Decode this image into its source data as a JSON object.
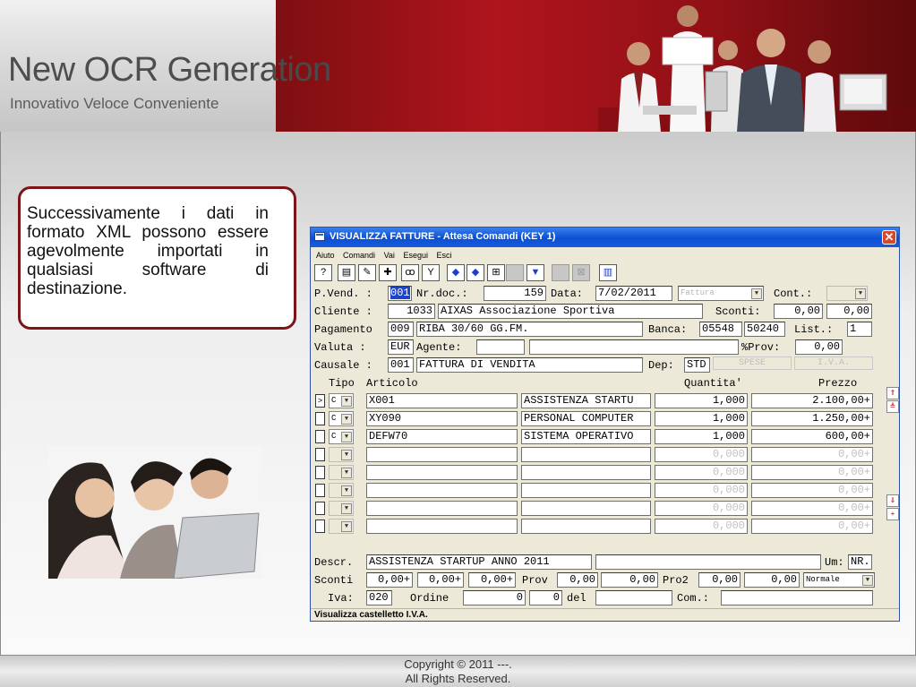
{
  "header": {
    "title_part1": "New OCR Gene",
    "title_part2": "ration",
    "subtitle": "Innovativo Veloce Conveniente"
  },
  "callout": {
    "text": "Successivamente i dati in formato XML possono essere agevolmente importati in qualsiasi software di destinazione."
  },
  "window": {
    "title": "VISUALIZZA FATTURE - Attesa Comandi (KEY 1)",
    "close_label": "✕",
    "menu": [
      "Aiuto",
      "Comandi",
      "Vai",
      "Esegui",
      "Esci"
    ],
    "toolbar_icons": [
      "help-icon",
      "print-icon",
      "edit-icon",
      "edit-add-icon",
      "binoculars-icon",
      "filter-icon",
      "arrow-left-icon",
      "arrow-right-icon",
      "open-icon",
      "blank-icon",
      "arrow-down-icon",
      "blank-icon",
      "close-icon",
      "chart-icon"
    ],
    "status": "Visualizza castelletto I.V.A."
  },
  "form": {
    "pvend_label": "P.Vend. :",
    "pvend": "001",
    "nrdoc_label": "Nr.doc.:",
    "nrdoc": "159",
    "data_label": "Data:",
    "data": "7/02/2011",
    "doc_type": "Fattura",
    "cont_label": "Cont.:",
    "cliente_label": "Cliente :",
    "cliente_code": "1033",
    "cliente_name": "AIXAS Associazione Sportiva",
    "sconti_label": "Sconti:",
    "sconti1": "0,00",
    "sconti2": "0,00",
    "pagamento_label": "Pagamento",
    "pagamento_code": "009",
    "pagamento_desc": "RIBA 30/60 GG.FM.",
    "banca_label": "Banca:",
    "banca1": "05548",
    "banca2": "50240",
    "list_label": "List.:",
    "list": "1",
    "valuta_label": "Valuta  :",
    "valuta": "EUR",
    "agente_label": "Agente:",
    "prov_label": "%Prov:",
    "prov": "0,00",
    "causale_label": "Causale :",
    "causale_code": "001",
    "causale_desc": "FATTURA DI VENDITA",
    "dep_label": "Dep:",
    "dep": "STD",
    "spese": "SPESE",
    "iva_btn": "I.V.A."
  },
  "grid": {
    "headers": {
      "tipo": "Tipo",
      "articolo": "Articolo",
      "quantita": "Quantita'",
      "prezzo": "Prezzo"
    },
    "rows": [
      {
        "marker": ">",
        "tipo": "C",
        "code": "X001",
        "desc": "ASSISTENZA STARTU",
        "qty": "1,000",
        "price": "2.100,00+"
      },
      {
        "marker": "",
        "tipo": "C",
        "code": "XY090",
        "desc": "PERSONAL COMPUTER",
        "qty": "1,000",
        "price": "1.250,00+"
      },
      {
        "marker": "",
        "tipo": "C",
        "code": "DEFW70",
        "desc": "SISTEMA OPERATIVO",
        "qty": "1,000",
        "price": "600,00+"
      },
      {
        "marker": "",
        "tipo": "",
        "code": "",
        "desc": "",
        "qty": "0,000",
        "price": "0,00+"
      },
      {
        "marker": "",
        "tipo": "",
        "code": "",
        "desc": "",
        "qty": "0,000",
        "price": "0,00+"
      },
      {
        "marker": "",
        "tipo": "",
        "code": "",
        "desc": "",
        "qty": "0,000",
        "price": "0,00+"
      },
      {
        "marker": "",
        "tipo": "",
        "code": "",
        "desc": "",
        "qty": "0,000",
        "price": "0,00+"
      },
      {
        "marker": "",
        "tipo": "",
        "code": "",
        "desc": "",
        "qty": "0,000",
        "price": "0,00+"
      }
    ]
  },
  "bottom": {
    "descr_label": "Descr.",
    "descr": "ASSISTENZA STARTUP ANNO 2011",
    "um_label": "Um:",
    "um": "NR.",
    "sconti_label": "Sconti",
    "sc1": "0,00+",
    "sc2": "0,00+",
    "sc3": "0,00+",
    "prov_label": "Prov",
    "prov1": "0,00",
    "prov2": "0,00",
    "pro2_label": "Pro2",
    "pro2a": "0,00",
    "pro2b": "0,00",
    "tipo_sel": "Normale",
    "iva_label": "Iva:",
    "iva": "020",
    "ordine_label": "Ordine",
    "ordine1": "0",
    "ordine2": "0",
    "del_label": "del",
    "com_label": "Com.:"
  },
  "footer": {
    "line1": "Copyright © 2011 ---.",
    "line2": "All Rights Reserved."
  }
}
